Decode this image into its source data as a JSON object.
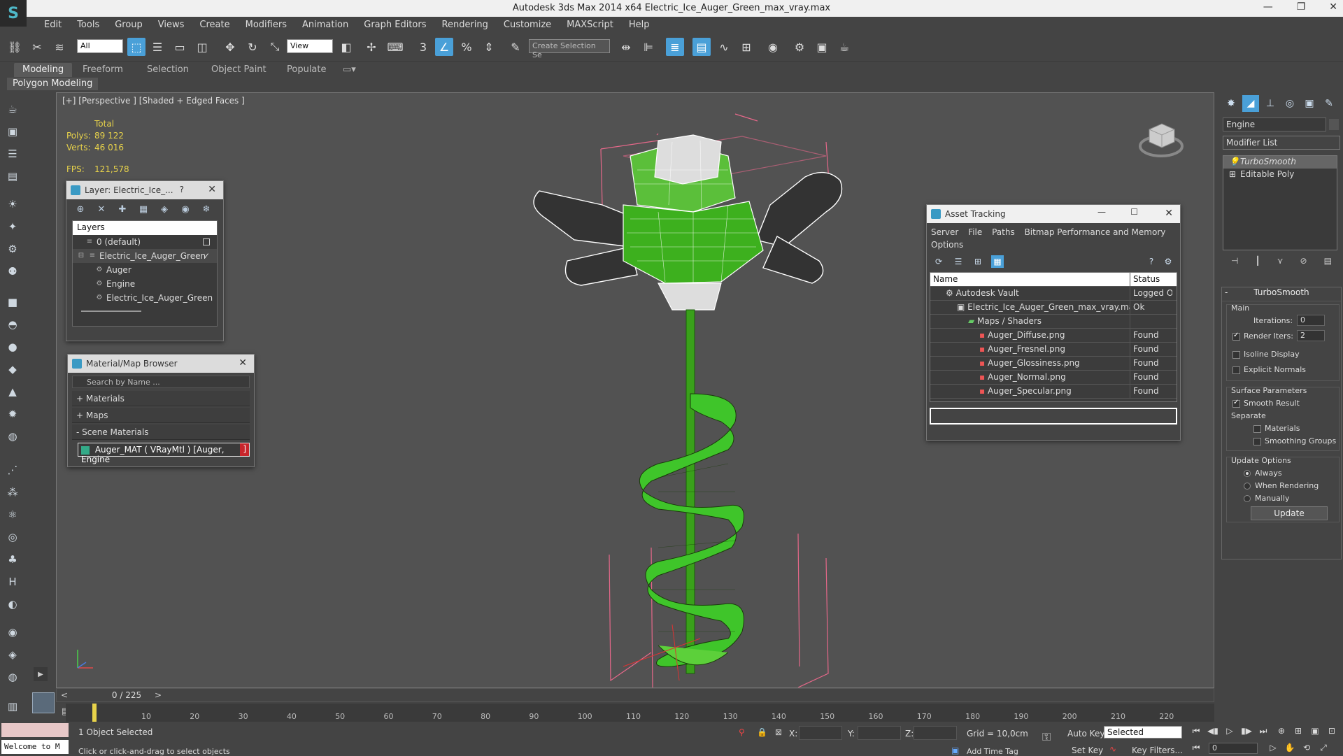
{
  "window": {
    "title": "Autodesk 3ds Max  2014 x64     Electric_Ice_Auger_Green_max_vray.max"
  },
  "menu": [
    "Edit",
    "Tools",
    "Group",
    "Views",
    "Create",
    "Modifiers",
    "Animation",
    "Graph Editors",
    "Rendering",
    "Customize",
    "MAXScript",
    "Help"
  ],
  "toolbar": {
    "filter_value": "All",
    "ref_coord_value": "View",
    "selection_set_placeholder": "Create Selection Se"
  },
  "ribbon": {
    "tabs": [
      "Modeling",
      "Freeform",
      "Selection",
      "Object Paint",
      "Populate"
    ],
    "sub_label": "Polygon Modeling"
  },
  "viewport": {
    "label": "[+] [Perspective ] [Shaded + Edged Faces ]",
    "stats": {
      "total_label": "Total",
      "polys_label": "Polys:",
      "polys_value": "89 122",
      "verts_label": "Verts:",
      "verts_value": "46 016",
      "fps_label": "FPS:",
      "fps_value": "121,578"
    }
  },
  "layer_panel": {
    "title": "Layer: Electric_Ice_...",
    "help": "?",
    "header": "Layers",
    "rows": [
      {
        "label": "0 (default)"
      },
      {
        "label": "Electric_Ice_Auger_Green"
      },
      {
        "label": "Auger"
      },
      {
        "label": "Engine"
      },
      {
        "label": "Electric_Ice_Auger_Green"
      }
    ]
  },
  "material_panel": {
    "title": "Material/Map Browser",
    "search_placeholder": "Search by Name ...",
    "groups": [
      "+ Materials",
      "+ Maps",
      "- Scene Materials"
    ],
    "item_main": "Auger_MAT ( VRayMtl ) [Auger, Engine",
    "item_tail": "]"
  },
  "asset_panel": {
    "title": "Asset Tracking",
    "menu": [
      "Server",
      "File",
      "Paths",
      "Bitmap Performance and Memory",
      "Options"
    ],
    "columns": {
      "name": "Name",
      "status": "Status"
    },
    "rows": [
      {
        "name": "Autodesk Vault",
        "status": "Logged O"
      },
      {
        "name": "Electric_Ice_Auger_Green_max_vray.max",
        "status": "Ok"
      },
      {
        "name": "Maps / Shaders",
        "status": ""
      },
      {
        "name": "Auger_Diffuse.png",
        "status": "Found"
      },
      {
        "name": "Auger_Fresnel.png",
        "status": "Found"
      },
      {
        "name": "Auger_Glossiness.png",
        "status": "Found"
      },
      {
        "name": "Auger_Normal.png",
        "status": "Found"
      },
      {
        "name": "Auger_Specular.png",
        "status": "Found"
      }
    ]
  },
  "command_panel": {
    "object_name": "Engine",
    "modifier_list": "Modifier List",
    "stack": [
      "TurboSmooth",
      "Editable Poly"
    ],
    "rollout_title": "TurboSmooth",
    "main_group": "Main",
    "iterations_label": "Iterations:",
    "iterations_value": "0",
    "render_iters_label": "Render Iters:",
    "render_iters_value": "2",
    "isoline": "Isoline Display",
    "explicit": "Explicit Normals",
    "surface_group": "Surface Parameters",
    "smooth_result": "Smooth Result",
    "separate": "Separate",
    "sep_materials": "Materials",
    "sep_smoothing": "Smoothing Groups",
    "update_group": "Update Options",
    "always": "Always",
    "when_rendering": "When Rendering",
    "manually": "Manually",
    "update_btn": "Update"
  },
  "timeline": {
    "label": "0 / 225",
    "ticks": [
      "10",
      "20",
      "30",
      "40",
      "50",
      "60",
      "70",
      "80",
      "90",
      "100",
      "110",
      "120",
      "130",
      "140",
      "150",
      "160",
      "170",
      "180",
      "190",
      "200",
      "210",
      "220"
    ]
  },
  "status": {
    "maxscript": "Welcome to M",
    "selected": "1 Object Selected",
    "hint": "Click or click-and-drag to select objects",
    "x": "X:",
    "y": "Y:",
    "z": "Z:",
    "grid": "Grid = 10,0cm",
    "auto_key": "Auto Key",
    "selected_drop": "Selected",
    "set_key": "Set Key",
    "key_filters": "Key Filters...",
    "add_time_tag": "Add Time Tag",
    "frame": "0"
  }
}
